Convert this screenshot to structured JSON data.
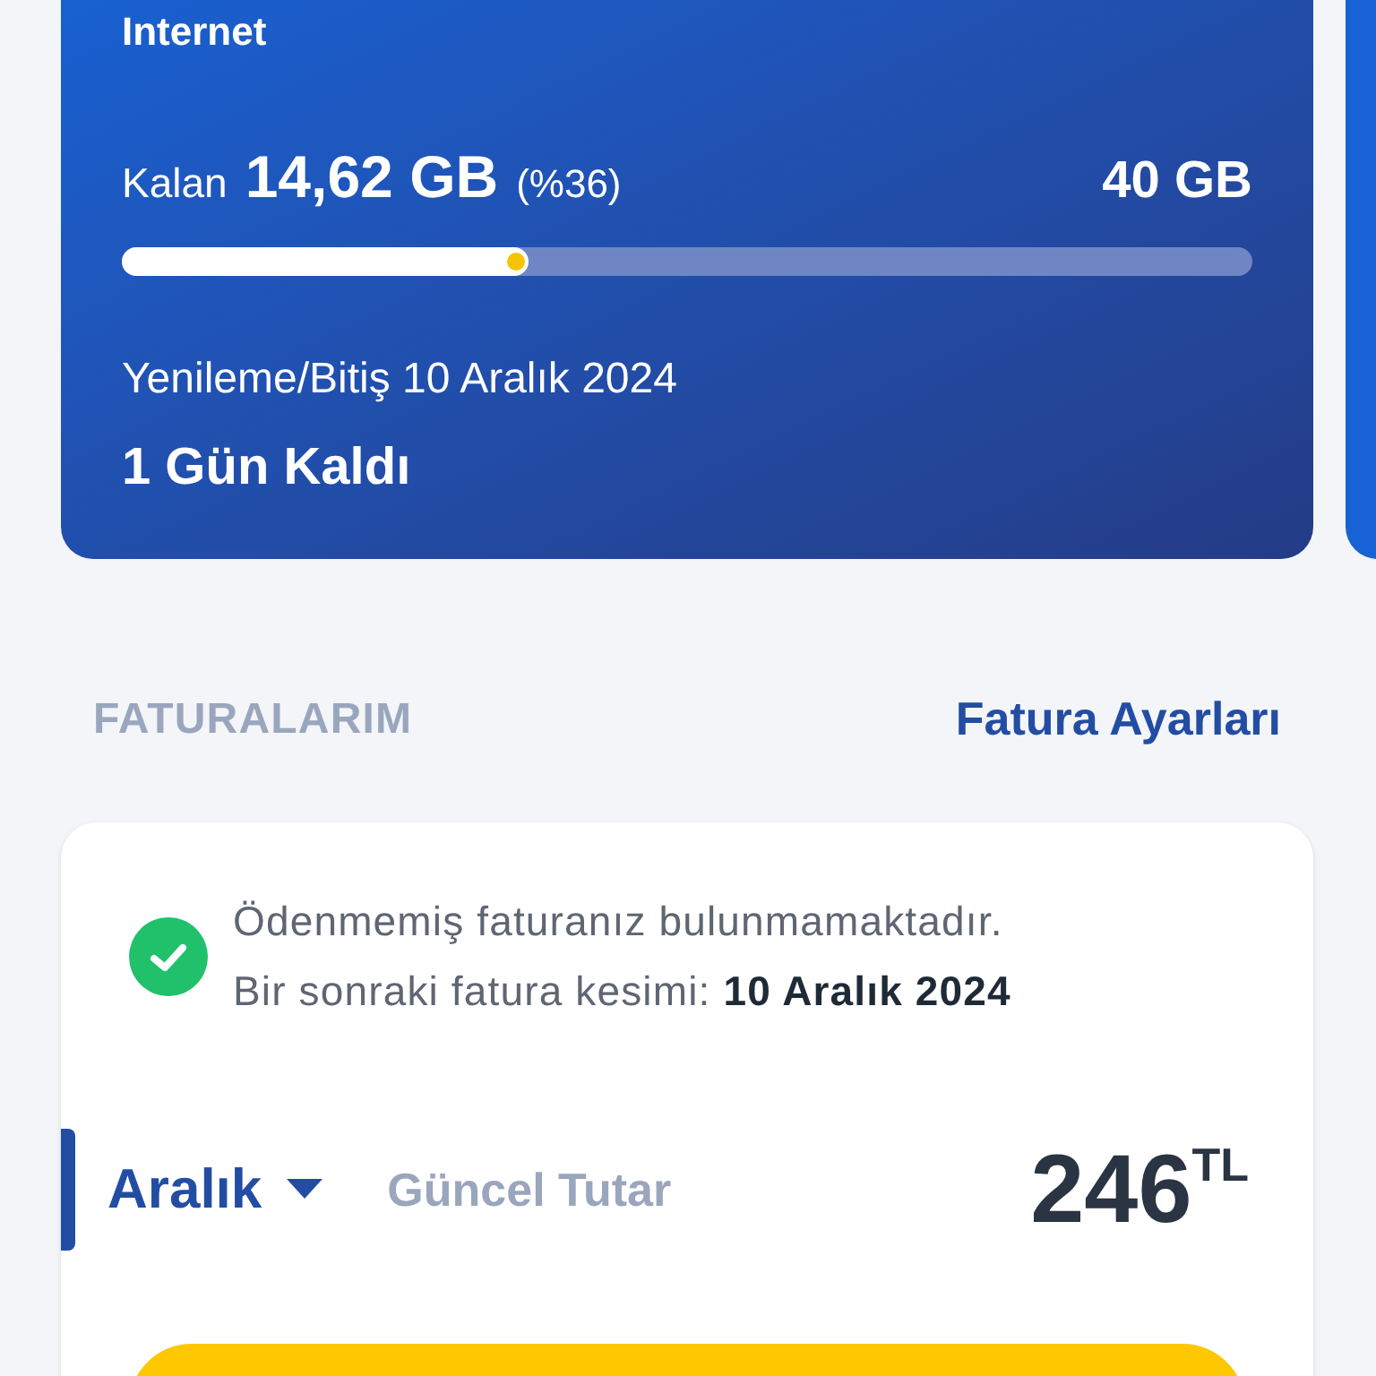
{
  "data_card": {
    "title": "Internet",
    "remaining_label": "Kalan",
    "remaining": "14,62 GB",
    "percent": "(%36)",
    "total": "40 GB",
    "level": 0.36,
    "renewal": "Yenileme/Bitiş 10 Aralık 2024",
    "days_left": "1 Gün Kaldı"
  },
  "bills_section": {
    "title": "FATURALARIM",
    "settings_link": "Fatura Ayarları"
  },
  "bill_card": {
    "paid": true,
    "status": "Ödenmemiş faturanız bulunmamaktadır.",
    "next_bill": "Bir sonraki fatura kesimi: **10 Aralık 2024**",
    "month": "Aralık",
    "amount_label": "Güncel Tutar",
    "amount": "246",
    "currency": "TL"
  }
}
